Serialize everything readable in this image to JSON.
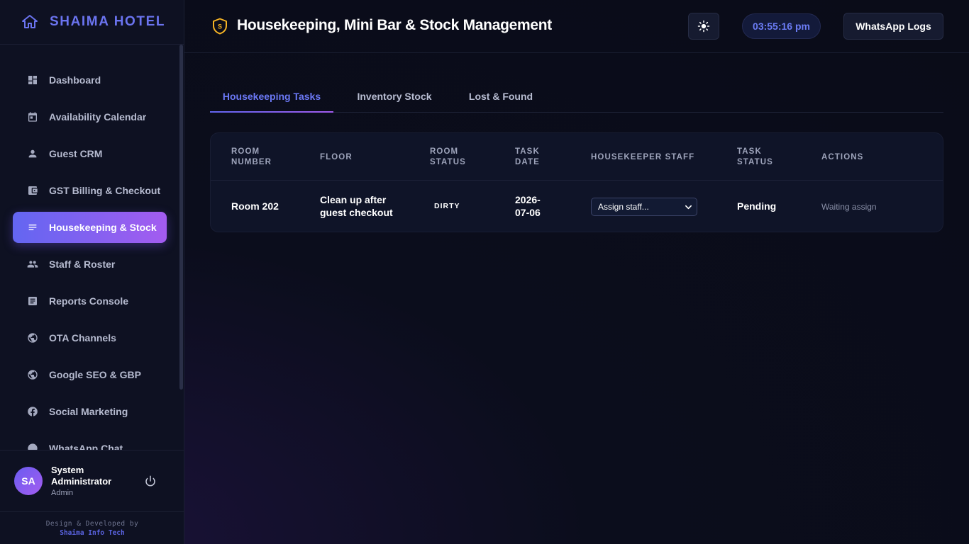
{
  "brand": {
    "name": "SHAIMA HOTEL"
  },
  "sidebar": {
    "items": [
      {
        "label": "Dashboard",
        "icon": "dashboard-icon"
      },
      {
        "label": "Availability Calendar",
        "icon": "calendar-icon"
      },
      {
        "label": "Guest CRM",
        "icon": "person-icon"
      },
      {
        "label": "GST Billing & Checkout",
        "icon": "wallet-icon"
      },
      {
        "label": "Housekeeping & Stock",
        "icon": "list-icon",
        "active": true
      },
      {
        "label": "Staff & Roster",
        "icon": "group-icon"
      },
      {
        "label": "Reports Console",
        "icon": "report-icon"
      },
      {
        "label": "OTA Channels",
        "icon": "globe-icon"
      },
      {
        "label": "Google SEO & GBP",
        "icon": "globe-icon"
      },
      {
        "label": "Social Marketing",
        "icon": "facebook-icon"
      },
      {
        "label": "WhatsApp Chat",
        "icon": "chat-icon"
      }
    ]
  },
  "user": {
    "initials": "SA",
    "name": "System Administrator",
    "role": "Admin"
  },
  "footer": {
    "line1": "Design & Developed by",
    "line2": "Shaima Info Tech"
  },
  "header": {
    "title": "Housekeeping, Mini Bar & Stock Management",
    "clock": "03:55:16 pm",
    "whatsapp_button": "WhatsApp Logs"
  },
  "tabs": [
    {
      "label": "Housekeeping Tasks",
      "active": true
    },
    {
      "label": "Inventory Stock",
      "active": false
    },
    {
      "label": "Lost & Found",
      "active": false
    }
  ],
  "table": {
    "headers": {
      "room_number": "Room Number",
      "floor": "Floor",
      "room_status": "Room Status",
      "task_date": "Task Date",
      "housekeeper": "Housekeeper Staff",
      "task_status": "Task Status",
      "actions": "Actions"
    },
    "rows": [
      {
        "room": "Room 202",
        "floor": "Clean up after guest checkout",
        "room_status": "DIRTY",
        "task_date": "2026-07-06",
        "housekeeper_selected": "Assign staff...",
        "task_status": "Pending",
        "action": "Waiting assign"
      }
    ]
  },
  "colors": {
    "accent": "#6366f1",
    "accent_end": "#a35cf0",
    "background": "#0b0d1c",
    "sidebar_bg": "#0e1122",
    "shield": "#f5b324"
  }
}
